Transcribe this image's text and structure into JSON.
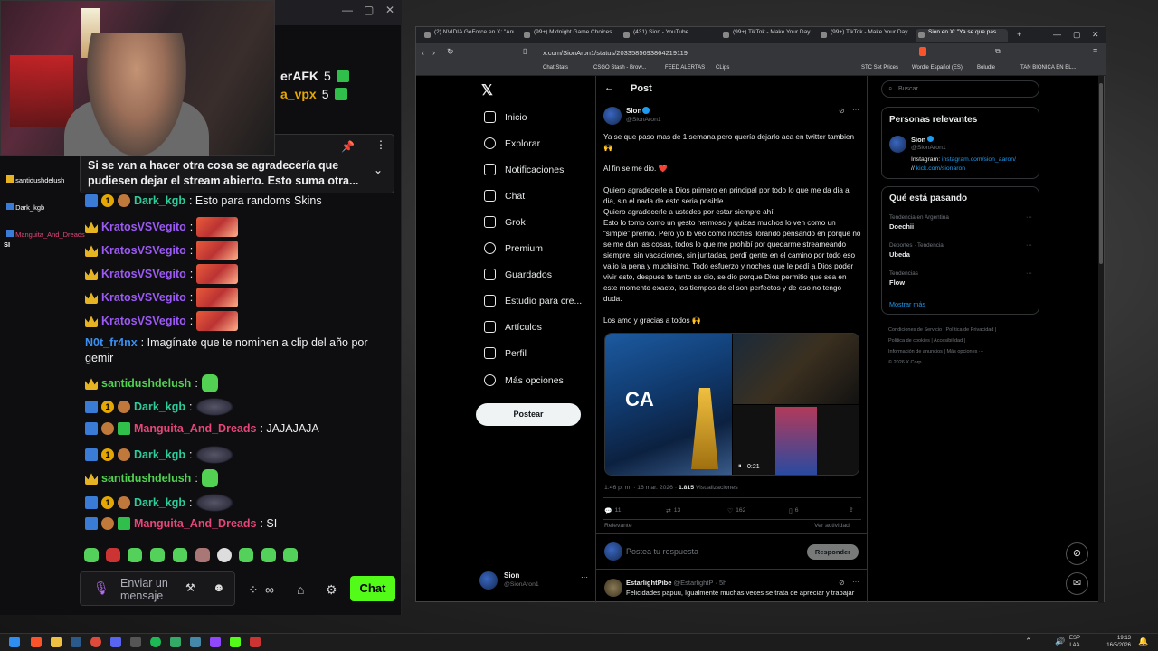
{
  "chat": {
    "top_users": [
      {
        "name": "erAFK",
        "count": "5"
      },
      {
        "name": "a_vpx",
        "count": "5"
      }
    ],
    "pinned_text": "Si se van a hacer otra cosa se agradecería que pudiesen dejar el stream abierto. Esto suma otra...",
    "overlay_names": [
      "santidushdelush",
      "Dark_kgb",
      "Manguita_And_Dreads",
      "SI"
    ],
    "messages": [
      {
        "user": "Dark_kgb",
        "text": ": Esto para randoms Skins"
      },
      {
        "user": "KratosVSVegito",
        "text": ":"
      },
      {
        "user": "KratosVSVegito",
        "text": ":"
      },
      {
        "user": "KratosVSVegito",
        "text": ":"
      },
      {
        "user": "KratosVSVegito",
        "text": ":"
      },
      {
        "user": "KratosVSVegito",
        "text": ":"
      },
      {
        "user": "N0t_fr4nx",
        "text": ": Imagínate que te nominen a clip del año por"
      },
      {
        "user": "",
        "text": "gemir"
      },
      {
        "user": "santidushdelush",
        "text": ":"
      },
      {
        "user": "Dark_kgb",
        "text": ":"
      },
      {
        "user": "Manguita_And_Dreads",
        "text": ": JAJAJAJA"
      },
      {
        "user": "Dark_kgb",
        "text": ":"
      },
      {
        "user": "santidushdelush",
        "text": ":"
      },
      {
        "user": "Dark_kgb",
        "text": ":"
      },
      {
        "user": "Manguita_And_Dreads",
        "text": ": SI"
      }
    ],
    "input_placeholder": "Enviar un mensaje",
    "chat_button": "Chat"
  },
  "browser": {
    "tabs": [
      "(2) NVIDIA GeForce en X: \"Ann...",
      "(99+) Midnight Game Choices #...",
      "(431) Sion - YouTube",
      "(99+) TikTok - Make Your Day",
      "(99+) TikTok - Make Your Day",
      "Sion en X: \"Ya se que pas..."
    ],
    "url": "x.com/SionAron1/status/2033585693864219119",
    "bookmarks": [
      "Chat Stats",
      "CSGO Stash - Brow...",
      "FEED ALERTAS",
      "CLips",
      "STC Set Prices",
      "Wordle Español (ES)",
      "Boludle",
      "TAN BIONICA EN EL..."
    ]
  },
  "x": {
    "nav": [
      "Inicio",
      "Explorar",
      "Notificaciones",
      "Chat",
      "Grok",
      "Premium",
      "Guardados",
      "Estudio para cre...",
      "Artículos",
      "Perfil",
      "Más opciones"
    ],
    "post_button": "Postear",
    "account": {
      "name": "Sion",
      "handle": "@SionAron1"
    },
    "header": "Post",
    "tweet": {
      "name": "Sion",
      "handle": "@SionAron1",
      "p1": "Ya se que paso mas de 1 semana pero quería dejarlo aca en twitter tambien 🙌",
      "p2": "Al fin se me dio. ❤️",
      "p3": "Quiero agradecerle a Dios primero en principal por todo lo que me da dia a dia, sin el nada de esto seria posible.",
      "p4": "Quiero agradecerle a ustedes por estar siempre ahí.",
      "p5": "Esto lo tomo como un gesto hermoso y quizas muchos lo ven como un “simple” premio. Pero yo lo veo como noches llorando pensando en porque no se me dan las cosas, todos lo que me prohibí por quedarme streameando siempre, sin vacaciones, sin juntadas, perdí gente en el camino por todo eso valio la pena y muchisimo. Todo esfuerzo y noches que le pedí a Dios poder vivir esto, despues te tanto se dio, se dio porque Dios permitio que sea en este momento exacto, los tiempos de el son perfectos y de eso no tengo duda.",
      "p6": "Los amo y gracias a todos 🙌",
      "video_time": "0:21",
      "media_text": "CA",
      "meta_time": "1:46 p. m. · 16 mar. 2026 · ",
      "views": "1.815",
      "views_label": " Visualizaciones",
      "replies": "11",
      "reposts": "13",
      "likes": "162",
      "bookmarks": "6",
      "relevante": "Relevante",
      "ver_actividad": "Ver actividad"
    },
    "reply_placeholder": "Postea tu respuesta",
    "reply_button": "Responder",
    "next_reply": {
      "name": "EstarlightPibe",
      "handle": "@EstarlightP · 5h",
      "text": "Felicidades papuu, Igualmente muchas veces se trata de apreciar y trabajar"
    },
    "search_placeholder": "Buscar",
    "relevant": {
      "title": "Personas relevantes",
      "name": "Sion",
      "handle": "@SionAron1",
      "bio_prefix": "Instagram: ",
      "bio_link": "instagram.com/sion_aaron/",
      "bio_sep": "// ",
      "bio_link2": "kick.com/sionaron"
    },
    "trends": {
      "title": "Qué está pasando",
      "items": [
        {
          "context": "Tendencia en Argentina",
          "name": "Doechii"
        },
        {
          "context": "Deportes · Tendencia",
          "name": "Ubeda"
        },
        {
          "context": "Tendencias",
          "name": "Flow"
        }
      ],
      "more": "Mostrar más"
    },
    "footer": [
      "Condiciones de Servicio",
      "Política de Privacidad",
      "Política de cookies",
      "Accesibilidad",
      "Información de anuncios",
      "Más opciones ···",
      "© 2026 X Corp."
    ]
  },
  "taskbar": {
    "lang": "ESP",
    "lang2": "LAA",
    "time": "19:13",
    "date": "16/5/2026"
  }
}
